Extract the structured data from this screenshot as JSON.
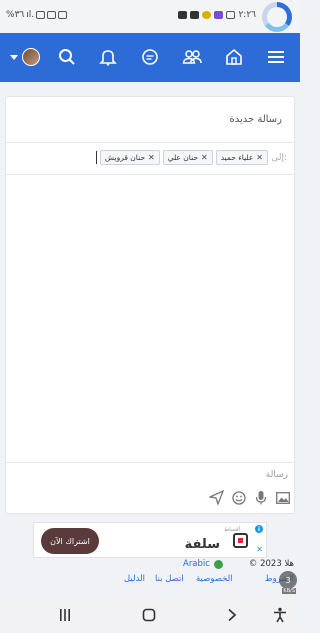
{
  "status_bar": {
    "time": "٢:٢٦",
    "battery": "%٣٦",
    "network": "ıl."
  },
  "colors": {
    "nav_bg": "#2d6bd6",
    "ad_button": "#5a3a3a",
    "link": "#2d6bd6"
  },
  "nav": {
    "icons": [
      "menu-icon",
      "home-icon",
      "users-icon",
      "chat-icon",
      "bell-icon",
      "search-icon",
      "avatar"
    ]
  },
  "composer": {
    "title": "رسالة جديدة",
    "to_label": "إلى:",
    "recipients": [
      "علياء حميد",
      "حنان علي",
      "حنان قرويش"
    ],
    "message_placeholder": "رسالة"
  },
  "ad": {
    "small_label": "أقساط",
    "brand": "سلفة",
    "button": "اشتراك الآن"
  },
  "footer": {
    "copyright": "© 2023 هلا",
    "language": "Arabic",
    "links": {
      "terms": "الشروط",
      "privacy": "الخصوصية",
      "contact": "اتصل بنا",
      "guide": "الدليل"
    },
    "badge_count": "3",
    "badge_sub": "KB/S"
  }
}
